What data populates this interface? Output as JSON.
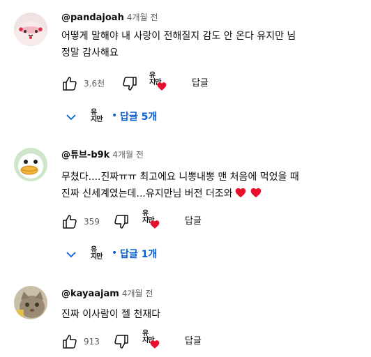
{
  "comments": [
    {
      "handle": "@pandajoah",
      "time": "4개월 전",
      "lines": [
        "어떻게 말해야 내 사랑이 전해질지 감도 안 온다 유지만 님",
        "정말 감사해요"
      ],
      "like_count": "3.6천",
      "reply_label": "답글",
      "replies_toggle": "답글 5개",
      "avatar_icon": "pink-plush-avatar"
    },
    {
      "handle": "@튜브-b9k",
      "time": "4개월 전",
      "lines": [
        "무쳤다....진짜ㅠㅠ 최고에요 니뽕내뽕 맨 처음에 먹었을 때",
        "진짜 신세계였는데...유지만님 버전 더조와"
      ],
      "like_count": "359",
      "reply_label": "답글",
      "replies_toggle": "답글 1개",
      "avatar_icon": "duck-avatar"
    },
    {
      "handle": "@kayaajam",
      "time": "4개월 전",
      "lines": [
        "진짜 이사람이 젤 천재다"
      ],
      "like_count": "913",
      "reply_label": "답글",
      "avatar_icon": "cat-avatar"
    }
  ],
  "creator_badge": {
    "line1": "유",
    "line2": "지만"
  },
  "colors": {
    "link_blue": "#065fd4",
    "heart_red": "#e8112d",
    "meta_gray": "#606060"
  }
}
